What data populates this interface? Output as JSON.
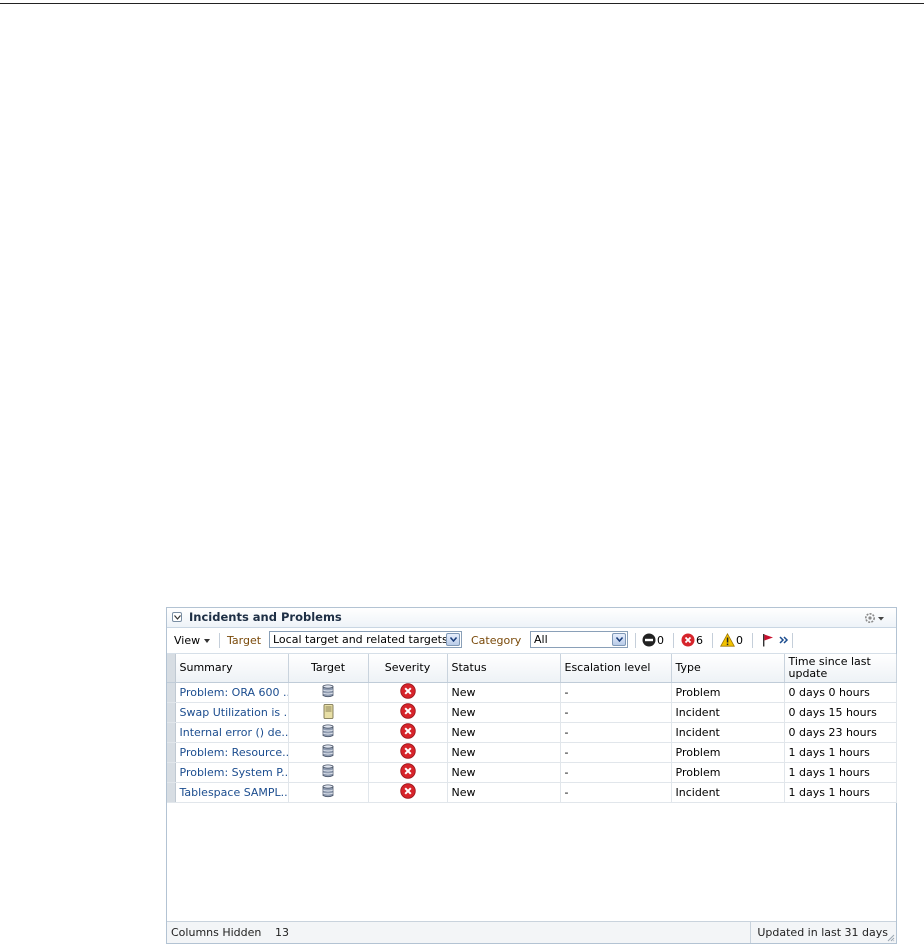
{
  "panel": {
    "title": "Incidents and Problems"
  },
  "toolbar": {
    "view_label": "View",
    "target_label": "Target",
    "target_value": "Local target and related targets",
    "category_label": "Category",
    "category_value": "All",
    "counts": {
      "blocked": "0",
      "critical": "6",
      "warning": "0"
    }
  },
  "table": {
    "columns": {
      "summary": "Summary",
      "target": "Target",
      "severity": "Severity",
      "status": "Status",
      "escalation": "Escalation level",
      "type": "Type",
      "time": "Time since last update"
    },
    "rows": [
      {
        "summary": "Problem: ORA 600 ...",
        "target_icon": "database-icon",
        "severity_icon": "critical-icon",
        "status": "New",
        "escalation": "-",
        "type": "Problem",
        "time": "0 days 0 hours"
      },
      {
        "summary": "Swap Utilization is ...",
        "target_icon": "host-icon",
        "severity_icon": "critical-icon",
        "status": "New",
        "escalation": "-",
        "type": "Incident",
        "time": "0 days 15 hours"
      },
      {
        "summary": "Internal error () de...",
        "target_icon": "database-icon",
        "severity_icon": "critical-icon",
        "status": "New",
        "escalation": "-",
        "type": "Incident",
        "time": "0 days 23 hours"
      },
      {
        "summary": "Problem: Resource...",
        "target_icon": "database-icon",
        "severity_icon": "critical-icon",
        "status": "New",
        "escalation": "-",
        "type": "Problem",
        "time": "1 days 1 hours"
      },
      {
        "summary": "Problem: System P...",
        "target_icon": "database-icon",
        "severity_icon": "critical-icon",
        "status": "New",
        "escalation": "-",
        "type": "Problem",
        "time": "1 days 1 hours"
      },
      {
        "summary": "Tablespace SAMPL...",
        "target_icon": "database-icon",
        "severity_icon": "critical-icon",
        "status": "New",
        "escalation": "-",
        "type": "Incident",
        "time": "1 days 1 hours"
      }
    ]
  },
  "footer": {
    "columns_hidden_label": "Columns Hidden",
    "columns_hidden_count": "13",
    "updated_text": "Updated in last 31 days"
  },
  "colors": {
    "link": "#1c4d8f",
    "critical": "#d6242b",
    "warning": "#f2c200",
    "label": "#7a4a0a"
  }
}
